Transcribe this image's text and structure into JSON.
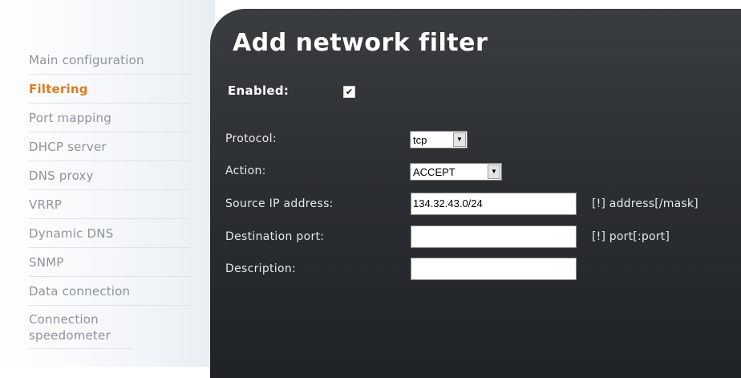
{
  "sidebar": {
    "items": [
      {
        "label": "Main configuration"
      },
      {
        "label": "Filtering"
      },
      {
        "label": "Port mapping"
      },
      {
        "label": "DHCP server"
      },
      {
        "label": "DNS proxy"
      },
      {
        "label": "VRRP"
      },
      {
        "label": "Dynamic DNS"
      },
      {
        "label": "SNMP"
      },
      {
        "label": "Data connection"
      },
      {
        "label": "Connection speedometer"
      }
    ],
    "active": "Filtering"
  },
  "page": {
    "title": "Add network filter"
  },
  "form": {
    "enabled": {
      "label": "Enabled:",
      "checked": true,
      "mark": "✔"
    },
    "protocol": {
      "label": "Protocol:",
      "value": "tcp"
    },
    "action": {
      "label": "Action:",
      "value": "ACCEPT"
    },
    "source_ip": {
      "label": "Source IP address:",
      "value": "134.32.43.0/24",
      "hint": "[!] address[/mask]"
    },
    "dest_port": {
      "label": "Destination port:",
      "value": "",
      "hint": "[!] port[:port]"
    },
    "description": {
      "label": "Description:",
      "value": ""
    }
  },
  "icons": {
    "dropdown": "chevron-down-icon",
    "check": "checkmark-icon"
  }
}
